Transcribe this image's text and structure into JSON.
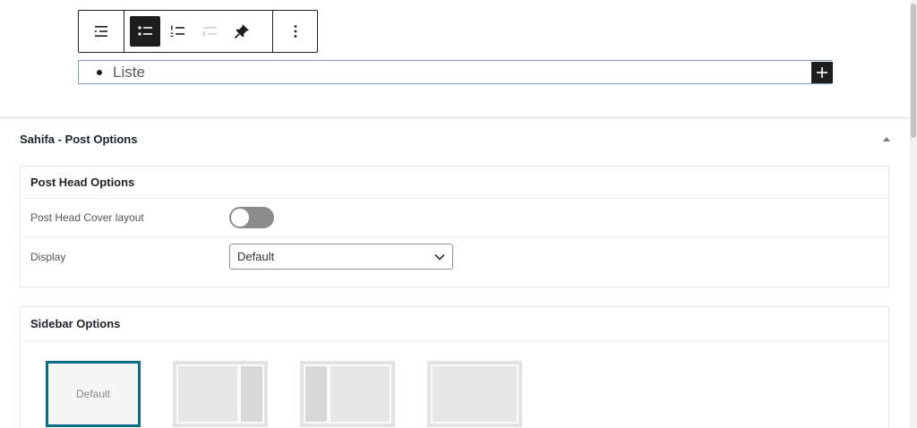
{
  "editor": {
    "toolbar": {
      "buttons": [
        {
          "icon": "block-type-list-icon"
        },
        {
          "icon": "unordered-list-icon",
          "active": true
        },
        {
          "icon": "ordered-list-icon"
        },
        {
          "icon": "outdent-icon"
        },
        {
          "icon": "pin-icon"
        },
        {
          "icon": "more-options-icon"
        }
      ]
    },
    "list_item": "Liste"
  },
  "metabox": {
    "title": "Sahifa - Post Options",
    "post_head": {
      "title": "Post Head Options",
      "cover_layout_label": "Post Head Cover layout",
      "cover_layout_enabled": false,
      "display_label": "Display",
      "display_value": "Default"
    },
    "sidebar": {
      "title": "Sidebar Options",
      "layouts": [
        {
          "name": "default",
          "label": "Default",
          "selected": true
        },
        {
          "name": "right-sidebar",
          "selected": false
        },
        {
          "name": "left-sidebar",
          "selected": false
        },
        {
          "name": "no-sidebar",
          "selected": false
        }
      ]
    }
  },
  "colors": {
    "accent_selected": "#0e6a87",
    "toolbar_active": "#1e1e1e"
  }
}
